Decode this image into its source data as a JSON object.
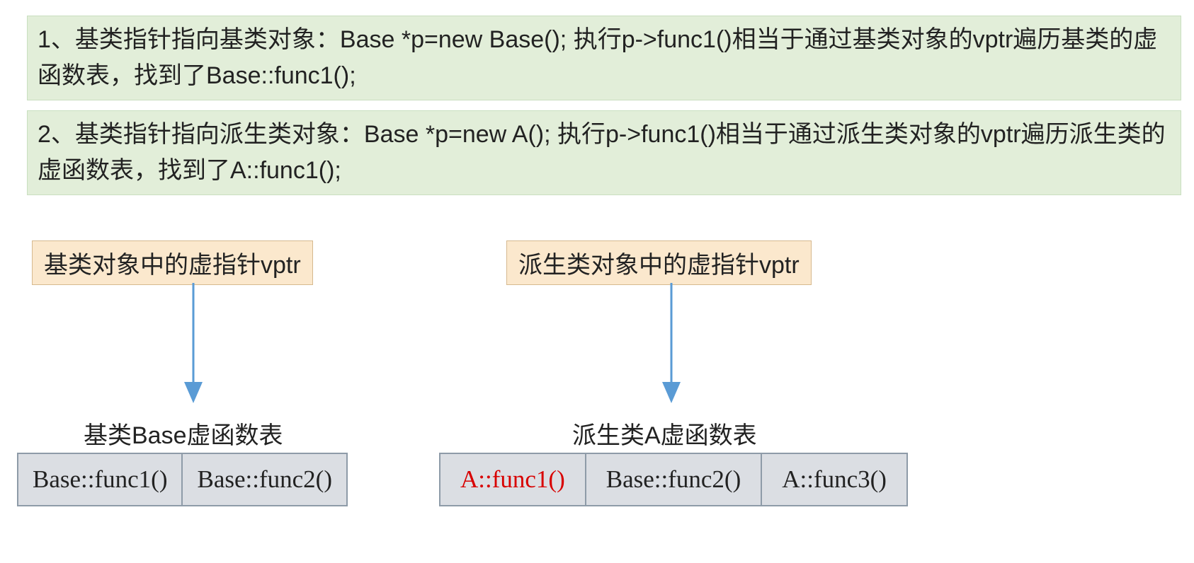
{
  "paragraphs": {
    "p1": "1、基类指针指向基类对象：Base *p=new Base(); 执行p->func1()相当于通过基类对象的vptr遍历基类的虚函数表，找到了Base::func1();",
    "p2": "2、基类指针指向派生类对象：Base *p=new A(); 执行p->func1()相当于通过派生类对象的vptr遍历派生类的虚函数表，找到了A::func1();"
  },
  "labels": {
    "vptr_base": "基类对象中的虚指针vptr",
    "vptr_derived": "派生类对象中的虚指针vptr"
  },
  "vtables": {
    "base": {
      "title": "基类Base虚函数表",
      "cells": [
        "Base::func1()",
        "Base::func2()"
      ]
    },
    "derived": {
      "title": "派生类A虚函数表",
      "cells": [
        "A::func1()",
        "Base::func2()",
        "A::func3()"
      ],
      "highlight_index": 0
    }
  }
}
